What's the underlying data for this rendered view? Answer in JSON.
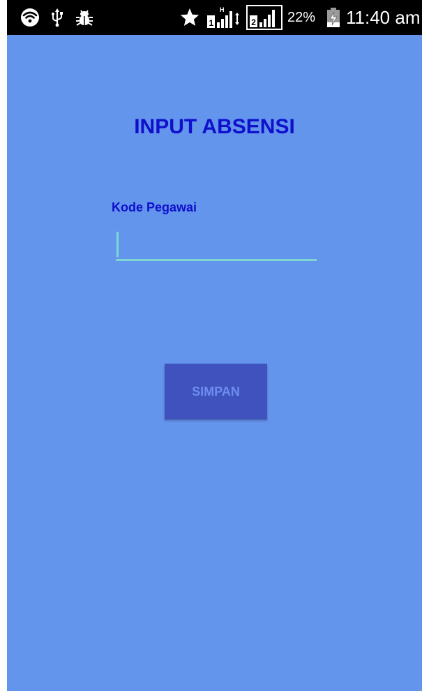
{
  "status_bar": {
    "icons": [
      "wifi-icon",
      "usb-icon",
      "debug-bug-icon",
      "star-icon",
      "signal-sim1-icon",
      "signal-sim2-icon",
      "battery-charging-icon"
    ],
    "battery_percent": "22%",
    "time": "11:40 am"
  },
  "screen": {
    "background_color": "#6495ed",
    "title": "INPUT ABSENSI",
    "title_color": "#0f0fcc",
    "field": {
      "label": "Kode Pegawai",
      "value": "",
      "accent_color": "#7fd6d0"
    },
    "save_button": {
      "label": "SIMPAN",
      "background_color": "#4052bd",
      "text_color": "#6c8ef0"
    }
  }
}
